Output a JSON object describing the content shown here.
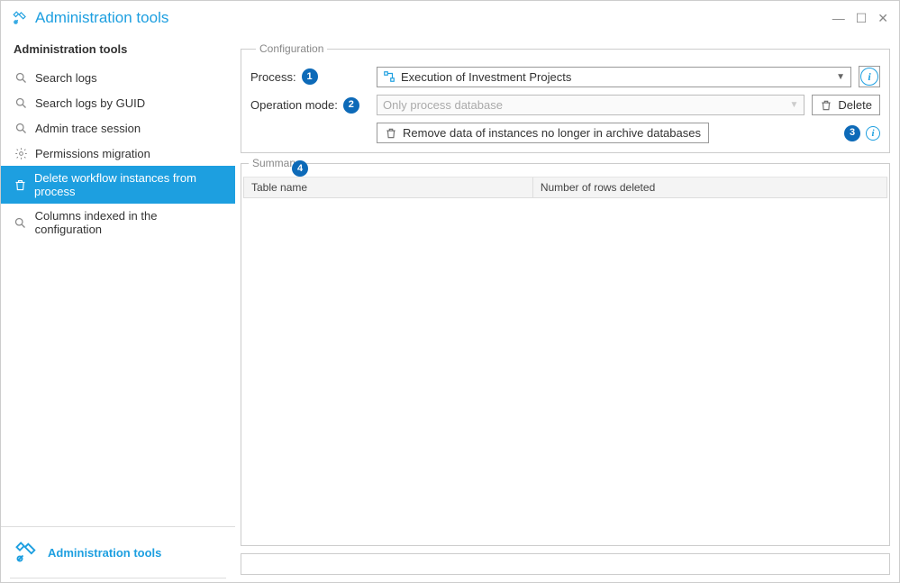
{
  "title": "Administration tools",
  "sidebar": {
    "header": "Administration tools",
    "items": [
      {
        "label": "Search logs",
        "icon": "search"
      },
      {
        "label": "Search logs by GUID",
        "icon": "search"
      },
      {
        "label": "Admin trace session",
        "icon": "search"
      },
      {
        "label": "Permissions migration",
        "icon": "gear"
      },
      {
        "label": "Delete workflow instances from process",
        "icon": "trash"
      },
      {
        "label": "Columns indexed in the configuration",
        "icon": "search"
      }
    ],
    "footer_label": "Administration tools"
  },
  "config": {
    "legend": "Configuration",
    "process_label": "Process:",
    "process_value": "Execution of Investment Projects",
    "operation_label": "Operation mode:",
    "operation_value": "Only process database",
    "delete_label": "Delete",
    "remove_button": "Remove data of instances no longer in archive databases",
    "badges": {
      "process": "1",
      "operation": "2",
      "delete": "3",
      "summary": "4"
    }
  },
  "summary": {
    "legend": "Summary",
    "col1": "Table name",
    "col2": "Number of rows deleted"
  }
}
